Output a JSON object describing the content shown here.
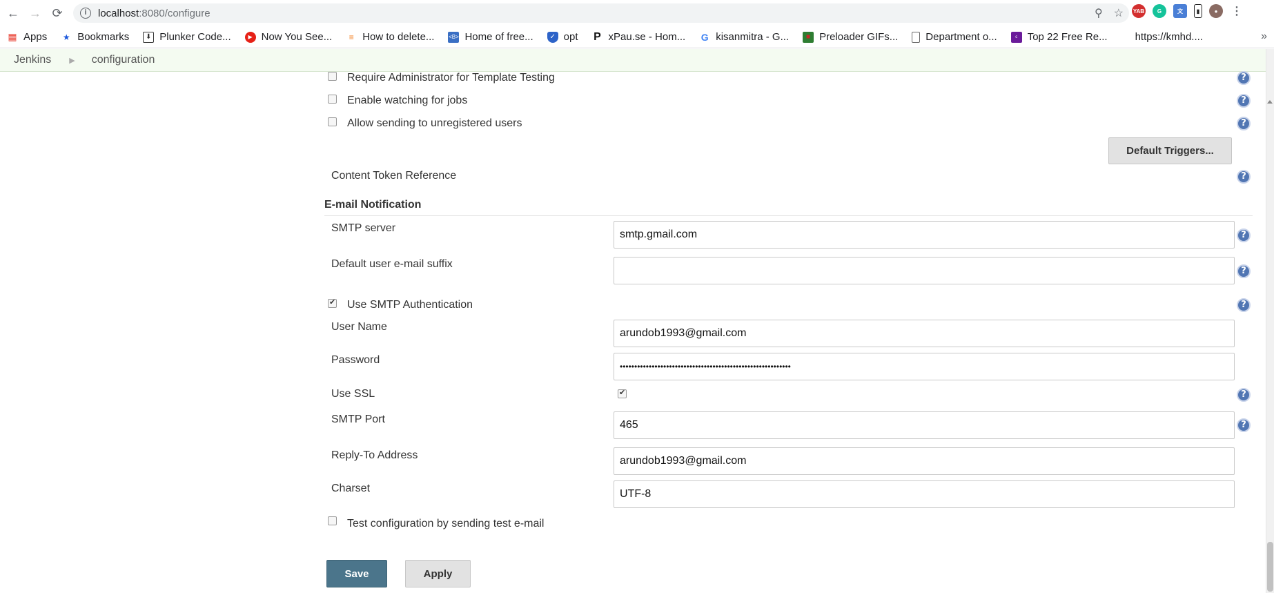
{
  "browser": {
    "url_host": "localhost",
    "url_path": ":8080/configure",
    "bookmarks": [
      {
        "label": "Apps",
        "icon": "apps-grid-icon"
      },
      {
        "label": "Bookmarks",
        "icon": "star-icon"
      },
      {
        "label": "Plunker Code...",
        "icon": "plunker-icon"
      },
      {
        "label": "Now You See...",
        "icon": "youtube-icon"
      },
      {
        "label": "How to delete...",
        "icon": "stackoverflow-icon"
      },
      {
        "label": "Home of free...",
        "icon": "bootstrap-icon"
      },
      {
        "label": "opt",
        "icon": "shield-icon"
      },
      {
        "label": "xPau.se - Hom...",
        "icon": "p-logo-icon"
      },
      {
        "label": "kisanmitra - G...",
        "icon": "google-icon"
      },
      {
        "label": "Preloader GIFs...",
        "icon": "preloader-icon"
      },
      {
        "label": "Department o...",
        "icon": "document-icon"
      },
      {
        "label": "Top 22 Free Re...",
        "icon": "colorlib-icon"
      },
      {
        "label": "https://kmhd....",
        "icon": ""
      }
    ]
  },
  "breadcrumb": {
    "root": "Jenkins",
    "current": "configuration"
  },
  "form": {
    "require_admin_label": "Require Administrator for Template Testing",
    "enable_watching_label": "Enable watching for jobs",
    "allow_unregistered_label": "Allow sending to unregistered users",
    "default_triggers_button": "Default Triggers...",
    "content_token_label": "Content Token Reference",
    "email_section_title": "E-mail Notification",
    "smtp_server_label": "SMTP server",
    "smtp_server_value": "smtp.gmail.com",
    "email_suffix_label": "Default user e-mail suffix",
    "email_suffix_value": "",
    "use_smtp_auth_label": "Use SMTP Authentication",
    "username_label": "User Name",
    "username_value": "arundob1993@gmail.com",
    "password_label": "Password",
    "password_value": "•••••••••••••••••••••••••••••••••••••••••••••••••••••••••••",
    "use_ssl_label": "Use SSL",
    "smtp_port_label": "SMTP Port",
    "smtp_port_value": "465",
    "reply_to_label": "Reply-To Address",
    "reply_to_value": "arundob1993@gmail.com",
    "charset_label": "Charset",
    "charset_value": "UTF-8",
    "test_config_label": "Test configuration by sending test e-mail",
    "save_button": "Save",
    "apply_button": "Apply",
    "help_glyph": "?"
  }
}
